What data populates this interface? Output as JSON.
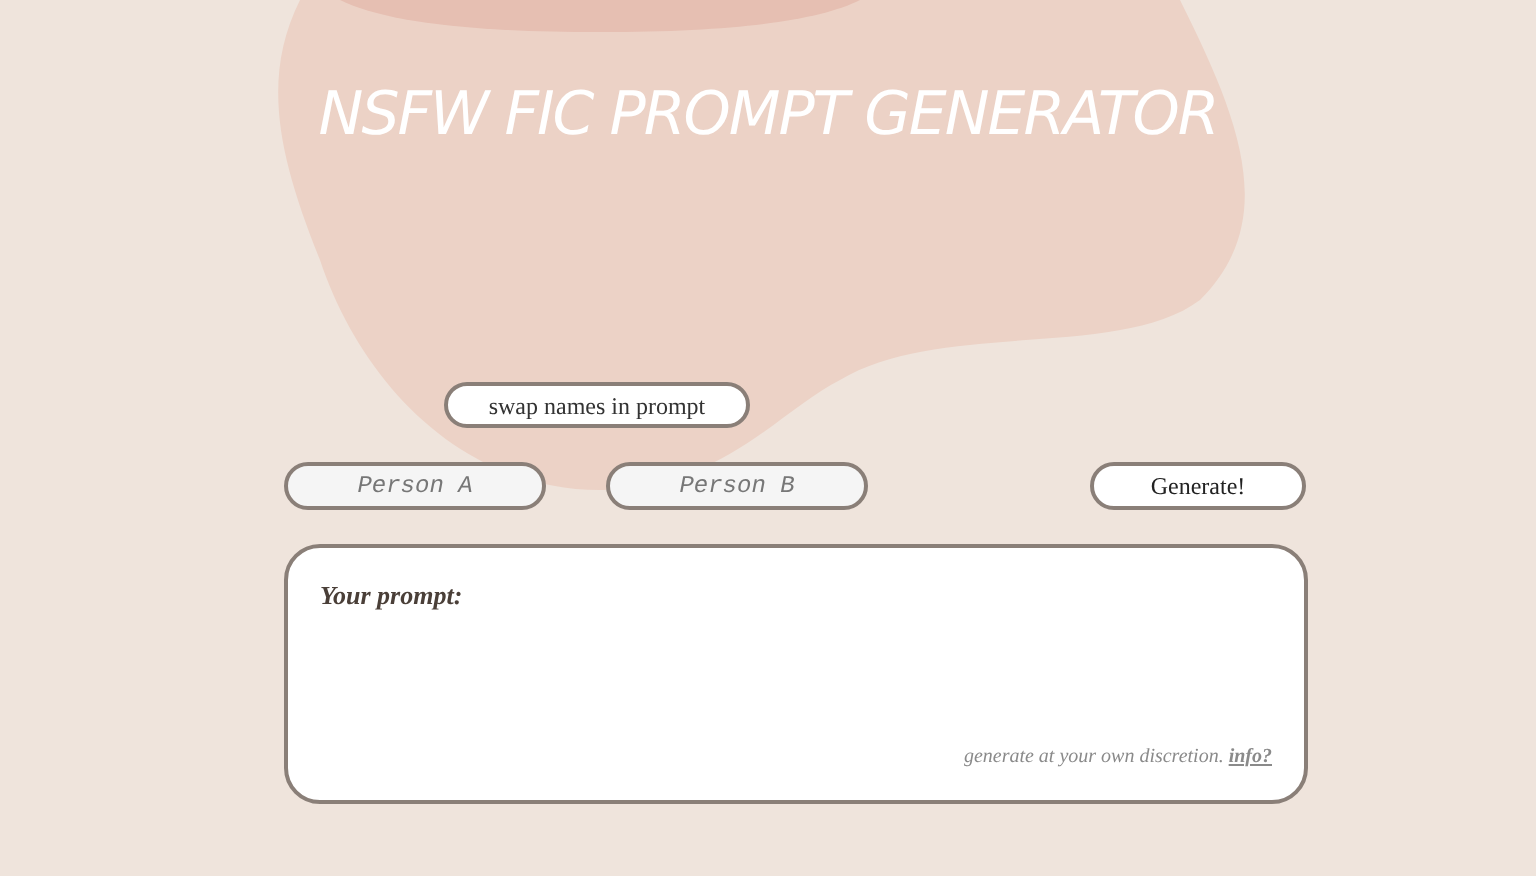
{
  "title": "NSFW FIC PROMPT GENERATOR",
  "swap_button": "swap names in prompt",
  "fields": [
    {
      "placeholder": "Person A"
    },
    {
      "placeholder": "Person B"
    }
  ],
  "generate_button": "Generate!",
  "prompt_box": {
    "label": "Your prompt:",
    "disclaimer": "generate at your own discretion.",
    "info_link": "info?"
  }
}
